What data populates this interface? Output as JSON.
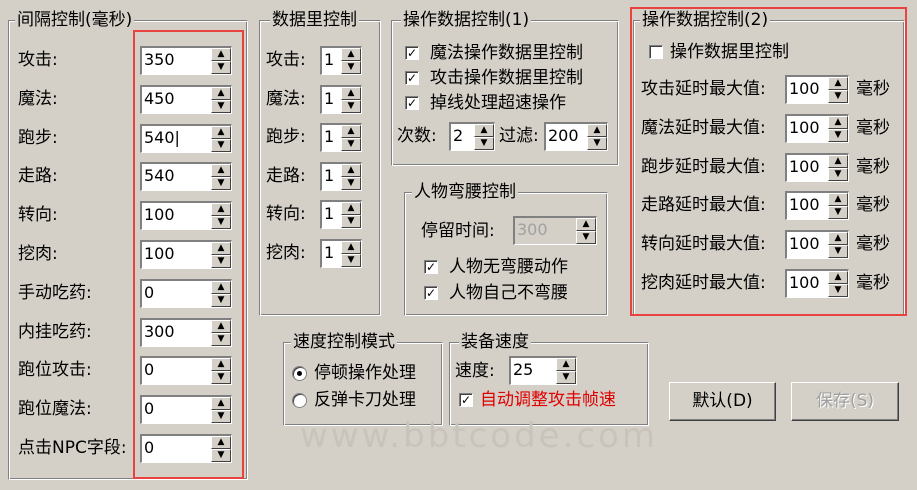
{
  "interval_group": {
    "title": "间隔控制(毫秒)",
    "rows": [
      {
        "label": "攻击:",
        "value": "350"
      },
      {
        "label": "魔法:",
        "value": "450"
      },
      {
        "label": "跑步:",
        "value": "540|"
      },
      {
        "label": "走路:",
        "value": "540"
      },
      {
        "label": "转向:",
        "value": "100"
      },
      {
        "label": "挖肉:",
        "value": "100"
      },
      {
        "label": "手动吃药:",
        "value": "0"
      },
      {
        "label": "内挂吃药:",
        "value": "300"
      },
      {
        "label": "跑位攻击:",
        "value": "0"
      },
      {
        "label": "跑位魔法:",
        "value": "0"
      },
      {
        "label": "点击NPC字段:",
        "value": "0"
      }
    ]
  },
  "count_group": {
    "title": "数据里控制",
    "rows": [
      {
        "label": "攻击:",
        "value": "1"
      },
      {
        "label": "魔法:",
        "value": "1"
      },
      {
        "label": "跑步:",
        "value": "1"
      },
      {
        "label": "走路:",
        "value": "1"
      },
      {
        "label": "转向:",
        "value": "1"
      },
      {
        "label": "挖肉:",
        "value": "1"
      }
    ]
  },
  "op1_group": {
    "title": "操作数据控制(1)",
    "checks": [
      {
        "label": "魔法操作数据里控制",
        "checked": "✓"
      },
      {
        "label": "攻击操作数据里控制",
        "checked": "✓"
      },
      {
        "label": "掉线处理超速操作",
        "checked": "✓"
      }
    ],
    "times_label": "次数:",
    "times_value": "2",
    "filter_label": "过滤:",
    "filter_value": "200"
  },
  "bend_group": {
    "title": "人物弯腰控制",
    "stay_label": "停留时间:",
    "stay_value": "300",
    "checks": [
      {
        "label": "人物无弯腰动作",
        "checked": "✓"
      },
      {
        "label": "人物自己不弯腰",
        "checked": "✓"
      }
    ]
  },
  "op2_group": {
    "title": "操作数据控制(2)",
    "main_check_label": "操作数据里控制",
    "main_check_mark": "",
    "unit": "毫秒",
    "rows": [
      {
        "label": "攻击延时最大值:",
        "value": "100"
      },
      {
        "label": "魔法延时最大值:",
        "value": "100"
      },
      {
        "label": "跑步延时最大值:",
        "value": "100"
      },
      {
        "label": "走路延时最大值:",
        "value": "100"
      },
      {
        "label": "转向延时最大值:",
        "value": "100"
      },
      {
        "label": "挖肉延时最大值:",
        "value": "100"
      }
    ]
  },
  "speed_mode_group": {
    "title": "速度控制模式",
    "options": [
      {
        "label": "停顿操作处理",
        "selected": true
      },
      {
        "label": "反弹卡刀处理",
        "selected": false
      }
    ]
  },
  "equip_group": {
    "title": "装备速度",
    "speed_label": "速度:",
    "speed_value": "25",
    "auto_label": "自动调整攻击帧速",
    "auto_mark": "✓"
  },
  "buttons": {
    "default_label": "默认(D)",
    "save_label": "保存(S)"
  },
  "watermark": "www.bbtcode.com",
  "colors": {
    "highlight": "#e8433f",
    "face": "#d4d0c8",
    "auto_text": "#e00000"
  }
}
